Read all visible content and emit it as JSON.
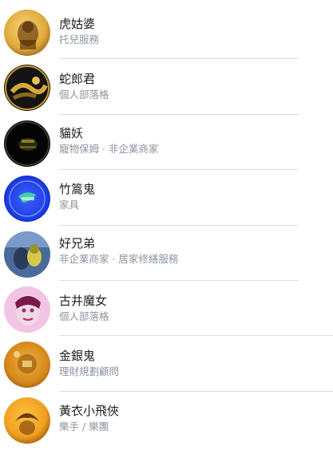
{
  "pages": [
    {
      "name": "虎姑婆",
      "category": "托兒服務",
      "avatar": "tiger-granny-avatar",
      "colors": [
        "#e8b847",
        "#9a6a1e"
      ]
    },
    {
      "name": "蛇郎君",
      "category": "個人部落格",
      "avatar": "snake-lord-avatar",
      "colors": [
        "#1a1a1a",
        "#c99a2e"
      ]
    },
    {
      "name": "貓妖",
      "category": "寵物保姆 · 非企業商家",
      "avatar": "cat-demon-avatar",
      "colors": [
        "#050505",
        "#8a7a2a"
      ]
    },
    {
      "name": "竹篙鬼",
      "category": "家具",
      "avatar": "bamboo-ghost-avatar",
      "colors": [
        "#1a3ce0",
        "#3ee0a0"
      ]
    },
    {
      "name": "好兄弟",
      "category": "非企業商家 · 居家修繕服務",
      "avatar": "good-brothers-avatar",
      "colors": [
        "#3a5a8a",
        "#d6c94a"
      ]
    },
    {
      "name": "古井魔女",
      "category": "個人部落格",
      "avatar": "well-witch-avatar",
      "colors": [
        "#f0a8d8",
        "#9a2a6a"
      ]
    },
    {
      "name": "金銀鬼",
      "category": "理財規劃顧問",
      "avatar": "gold-silver-ghost-avatar",
      "colors": [
        "#d6861a",
        "#7a4a10"
      ]
    },
    {
      "name": "黃衣小飛俠",
      "category": "樂手 / 樂團",
      "avatar": "yellow-flyer-avatar",
      "colors": [
        "#f0a020",
        "#6a3a08"
      ]
    }
  ]
}
